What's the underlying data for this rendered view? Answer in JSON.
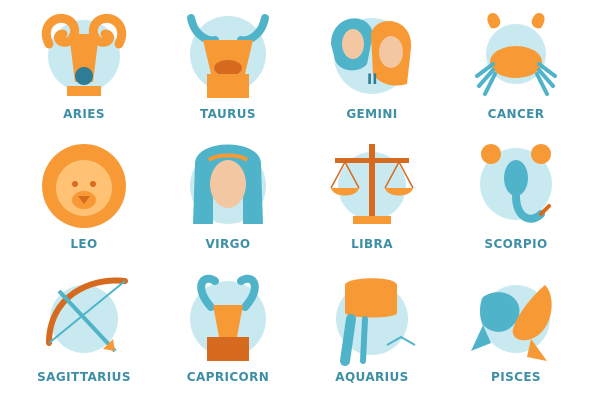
{
  "colors": {
    "orange": "#f79a36",
    "dark_orange": "#d66a1e",
    "teal": "#4fb3c9",
    "light_teal": "#c9e9f0",
    "label": "#3e8fa6"
  },
  "signs": [
    {
      "label": "ARIES",
      "icon": "ram-icon"
    },
    {
      "label": "TAURUS",
      "icon": "bull-icon"
    },
    {
      "label": "GEMINI",
      "icon": "twins-icon"
    },
    {
      "label": "CANCER",
      "icon": "crab-icon"
    },
    {
      "label": "LEO",
      "icon": "lion-icon"
    },
    {
      "label": "VIRGO",
      "icon": "maiden-icon"
    },
    {
      "label": "LIBRA",
      "icon": "scales-icon"
    },
    {
      "label": "SCORPIO",
      "icon": "scorpion-icon"
    },
    {
      "label": "SAGITTARIUS",
      "icon": "bow-arrow-icon"
    },
    {
      "label": "CAPRICORN",
      "icon": "goat-icon"
    },
    {
      "label": "AQUARIUS",
      "icon": "water-urn-icon"
    },
    {
      "label": "PISCES",
      "icon": "fish-icon"
    }
  ]
}
